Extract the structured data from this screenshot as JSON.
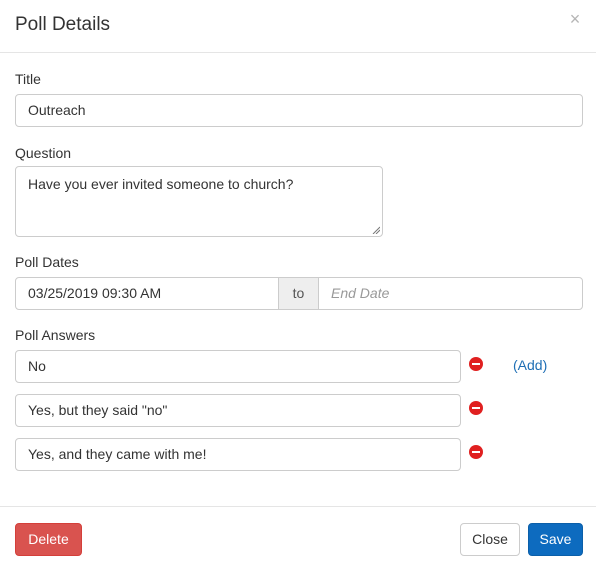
{
  "modal": {
    "title": "Poll Details",
    "close_icon": "×"
  },
  "form": {
    "title_label": "Title",
    "title_value": "Outreach",
    "question_label": "Question",
    "question_value": "Have you ever invited someone to church?",
    "dates_label": "Poll Dates",
    "start_date": "03/25/2019 09:30 AM",
    "to_label": "to",
    "end_date_placeholder": "End Date",
    "answers_label": "Poll Answers",
    "answers": [
      "No",
      "Yes, but they said \"no\"",
      "Yes, and they came with me!"
    ],
    "add_link": "(Add)"
  },
  "footer": {
    "delete_label": "Delete",
    "close_label": "Close",
    "save_label": "Save"
  },
  "colors": {
    "danger": "#d9534f",
    "primary": "#0d6bbf",
    "remove_icon": "#e02020",
    "link": "#1f6fb5"
  }
}
